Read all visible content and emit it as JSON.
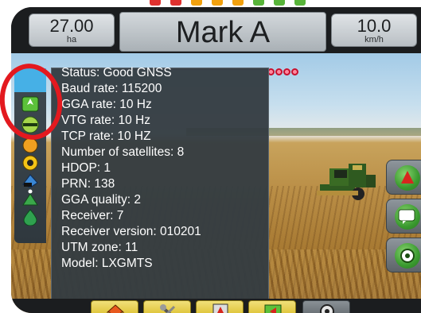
{
  "top_leds": [
    "#e0312f",
    "#e0312f",
    "#f2a10f",
    "#f2a10f",
    "#f2a10f",
    "#58b43a",
    "#58b43a",
    "#58b43a"
  ],
  "header": {
    "left_value": "27.00",
    "left_unit": "ha",
    "title": "Mark A",
    "right_value": "10.0",
    "right_unit": "km/h"
  },
  "gnss_info": [
    "Status: Good GNSS",
    "Baud rate:  115200",
    "GGA rate: 10 Hz",
    "VTG rate: 10 Hz",
    "TCP rate: 10 HZ",
    "Number of satellites: 8",
    "HDOP: 1",
    "PRN: 138",
    "GGA quality: 2",
    "Receiver: 7",
    "Receiver version: 010201",
    "UTM zone: 11",
    "Model: LXGMTS"
  ],
  "sidebar_icons": [
    "guidance-mode-icon",
    "gps-status-icon",
    "section-status-icon",
    "boom-icon",
    "tilt-icon",
    "arrow-up-icon",
    "droplet-icon"
  ],
  "right_buttons": [
    "guidance-view-icon",
    "screen-options-icon",
    "zoom-icon"
  ],
  "bottom_tabs": [
    "home-icon",
    "tools-icon",
    "vehicle-view-icon",
    "field-view-icon",
    "gnss-view-icon"
  ],
  "colors": {
    "highlight_red": "#e3191f",
    "sidebar_blue": "#46b0e6",
    "tab_yellow": "#d8b91f",
    "accent_green": "#3a9a2f"
  }
}
